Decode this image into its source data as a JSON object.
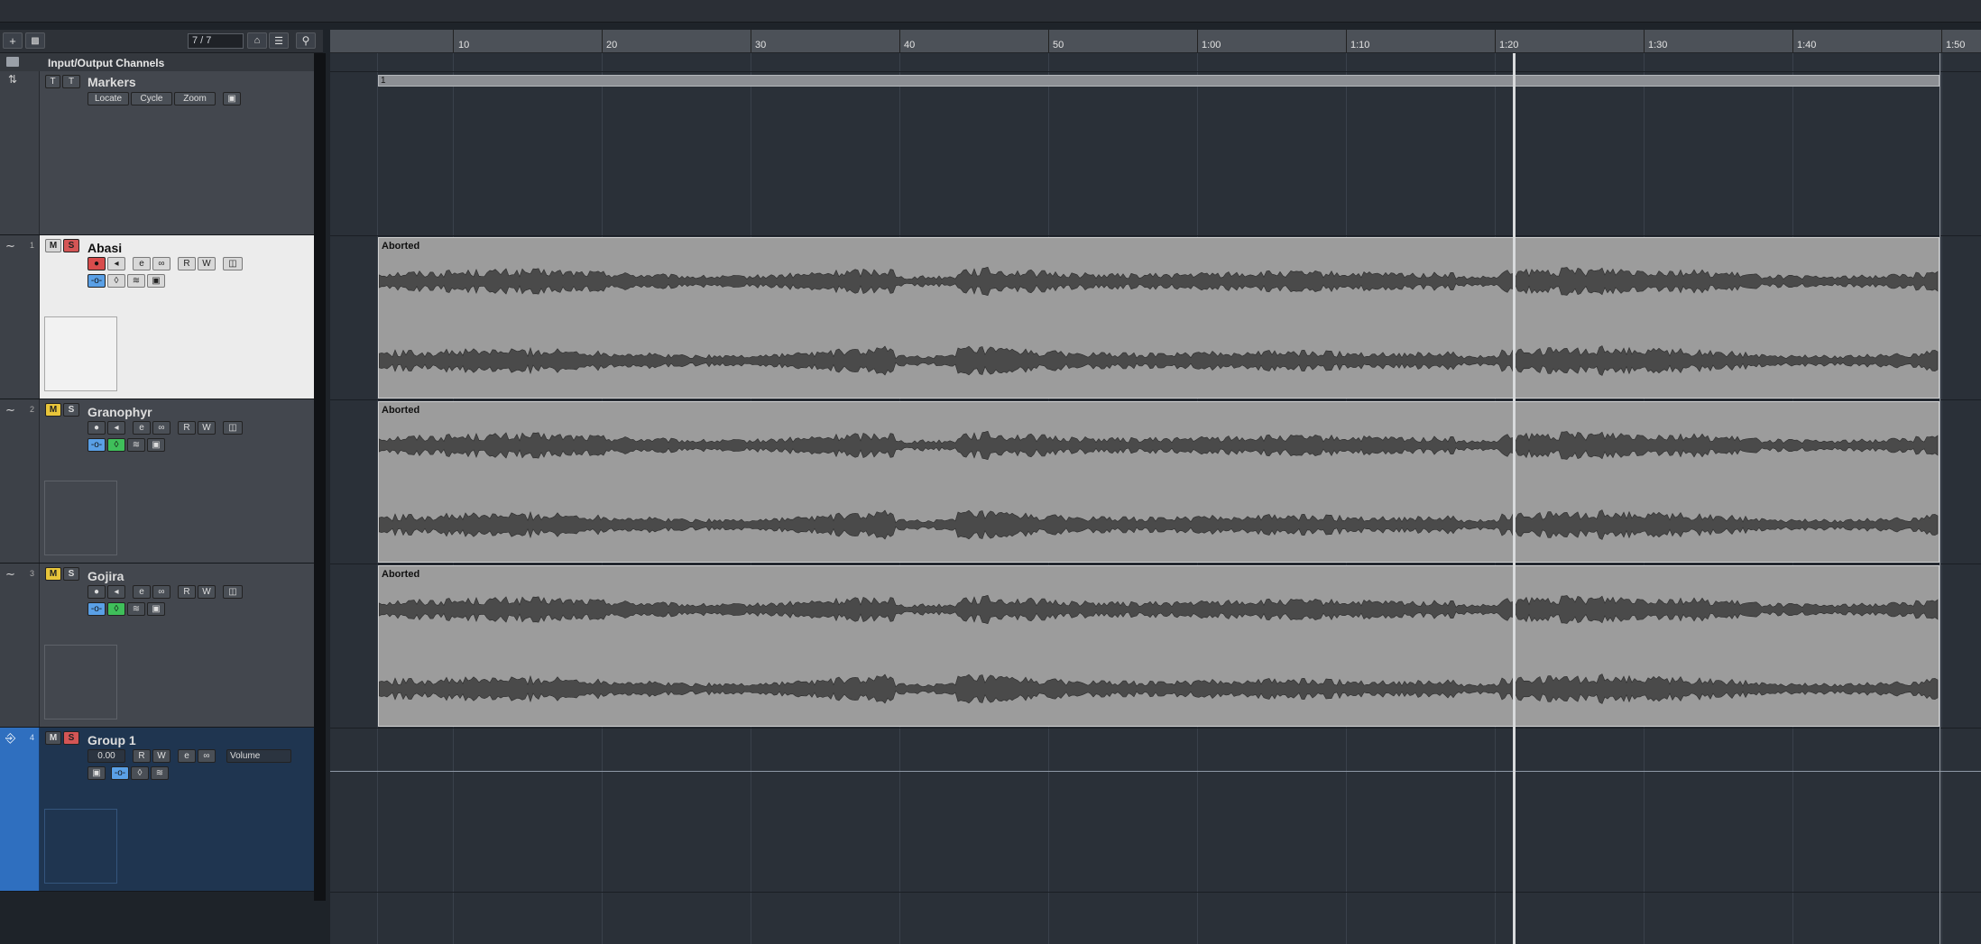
{
  "toolbar": {
    "track_counter": "7 / 7"
  },
  "folder": {
    "label": "Input/Output Channels"
  },
  "markers_track": {
    "name": "Markers",
    "buttons": [
      "Locate",
      "Cycle",
      "Zoom"
    ],
    "marker_label": "1"
  },
  "tracks": [
    {
      "number": "1",
      "name": "Abasi",
      "event_label": "Aborted"
    },
    {
      "number": "2",
      "name": "Granophyr",
      "event_label": "Aborted"
    },
    {
      "number": "3",
      "name": "Gojira",
      "event_label": "Aborted"
    }
  ],
  "group_track": {
    "number": "4",
    "name": "Group 1",
    "volume_value": "0.00",
    "automation_param": "Volume"
  },
  "buttons": {
    "mute": "M",
    "solo": "S",
    "read": "R",
    "write": "W"
  },
  "ruler": {
    "labels": [
      "10",
      "20",
      "30",
      "40",
      "50",
      "1:00",
      "1:10",
      "1:20",
      "1:30",
      "1:40",
      "1:50"
    ]
  },
  "colors": {
    "mute_active": "#e8c53a",
    "solo_active": "#d45555",
    "record_active": "#d84c4c",
    "monitor_active": "#5aa0e6",
    "edit_active": "#3fbf5a",
    "selected_track_bg": "#ececec",
    "group_track_bg": "#1f3550",
    "group_color_strip": "#2f6fbf",
    "event_bg": "#9c9c9c"
  }
}
